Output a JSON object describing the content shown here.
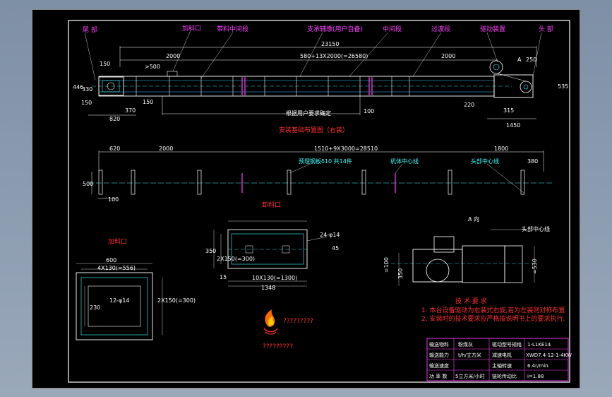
{
  "labels": {
    "tail": "尾 部",
    "feed_inlet": "加料口",
    "intermediate_with_inlet": "带料中间段",
    "support_pier": "支承辅墩(用户自备)",
    "intermediate": "中间段",
    "transition": "过渡段",
    "drive": "驱动装置",
    "head": "头 部",
    "view_a_mark": "A",
    "user_decide": "根据用户要求确定",
    "foundation_title": "安装基础布置图（右装）",
    "embedded_plate": "预埋钢板δ10 共14件",
    "machine_centerline": "机体中心线",
    "head_centerline": "头部中心线",
    "outlet_title": "卸料口",
    "inlet_title": "加料口",
    "view_a_title": "A 向",
    "head_centerline_2": "头部中心线",
    "logo_text": "?????????",
    "logo_text_big": "?????????"
  },
  "dims_top": {
    "d23150": "23150",
    "d2000a": "2000",
    "d580": "580+13X2000(=26580)",
    "d2000b": "2000",
    "d150": "150",
    "d500": ">500",
    "d446": "446",
    "d330": "330",
    "d150b": "150",
    "d370": "370",
    "d150c": "150",
    "d820": "820",
    "d100": "100",
    "d220": "220",
    "d315": "315",
    "d1450": "1450",
    "d250": "250",
    "d535": "535"
  },
  "dims_foundation": {
    "d620": "620",
    "d2000": "2000",
    "d1510": "1510+9X3000=28510",
    "d1800": "1800",
    "d380": "380",
    "d500": "500",
    "d100": "100"
  },
  "dims_outlet": {
    "d350": "350",
    "d2x150": "2X150(=300)",
    "d10x130": "10X130(=1300)",
    "d1348": "1348",
    "d15": "15",
    "holes": "24-φ14",
    "d45": "45"
  },
  "dims_inlet": {
    "d600": "600",
    "d4x130": "4X130(=556)",
    "holes": "12-φ14",
    "d230": "230",
    "d2x150": "2X150(=300)"
  },
  "dims_view_a": {
    "d100": "=100",
    "d350": "350",
    "d550": "=530"
  },
  "tech": {
    "title": "技 术 要 求",
    "line1": "1. 本台设备驱动为右装式右旋,若为左装则对称布置.",
    "line2": "2. 安装时的技术要求应严格按说明书上的要求执行."
  },
  "spec_table": {
    "rows": [
      [
        "输送物料",
        "粉煤灰",
        "驱动型号规格",
        "1-L1KE14"
      ],
      [
        "输送能力",
        "t/h/立方米",
        "减速电机",
        "XWD7.4-12-1-4KW"
      ],
      [
        "输送速度",
        "",
        "主轴转速",
        "6.4r/min"
      ],
      [
        "功 率 数",
        "5立方米/小时",
        "链轮传动比",
        "i=1.88"
      ]
    ]
  }
}
